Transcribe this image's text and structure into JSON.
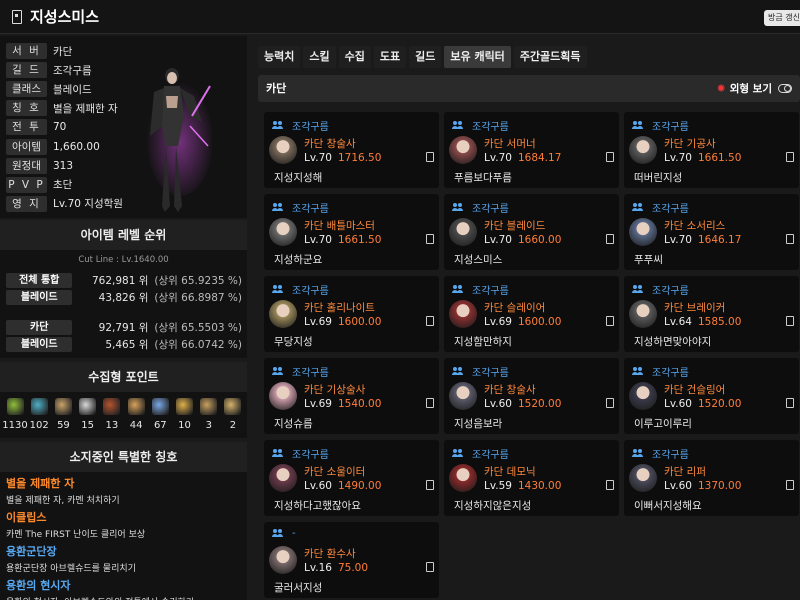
{
  "header": {
    "title": "지성스미스",
    "refresh_label": "방금 갱신"
  },
  "profile": {
    "rows": [
      {
        "label": "서 버",
        "value": "카단"
      },
      {
        "label": "길 드",
        "value": "조각구름"
      },
      {
        "label": "클래스",
        "value": "블레이드"
      },
      {
        "label": "칭 호",
        "value": "별을 제패한 자"
      },
      {
        "label": "전 투",
        "value": "70"
      },
      {
        "label": "아이템",
        "value": "1,660.00"
      },
      {
        "label": "원정대",
        "value": "313"
      },
      {
        "label": "P V P",
        "value": "초단"
      },
      {
        "label": "영 지",
        "value": "Lv.70 지성학원"
      }
    ]
  },
  "ranking": {
    "title": "아이템 레벨 순위",
    "cutline": "Cut Line : Lv.1640.00",
    "rows": [
      {
        "label": "전체 통합",
        "rank": "762,981 위",
        "pct": "(상위  65.9235 %)"
      },
      {
        "label": "블레이드",
        "rank": "43,826 위",
        "pct": "(상위  66.8987 %)"
      },
      {
        "label": "카단",
        "rank": "92,791 위",
        "pct": "(상위  65.5503 %)"
      },
      {
        "label": "블레이드",
        "rank": "5,465 위",
        "pct": "(상위  66.0742 %)"
      }
    ]
  },
  "points": {
    "title": "수집형 포인트",
    "items": [
      {
        "icon": "mokoko-seed-icon",
        "value": "1130",
        "color": "#8fbf3a"
      },
      {
        "icon": "island-heart-icon",
        "value": "102",
        "color": "#4fb0c6"
      },
      {
        "icon": "art-map-icon",
        "value": "59",
        "color": "#c9a36a"
      },
      {
        "icon": "giant-heart-icon",
        "value": "15",
        "color": "#d8d8d8"
      },
      {
        "icon": "ignea-token-icon",
        "value": "13",
        "color": "#b5542f"
      },
      {
        "icon": "adventure-tome-icon",
        "value": "44",
        "color": "#d8a25a"
      },
      {
        "icon": "world-tree-leaf-icon",
        "value": "67",
        "color": "#7aa8e6"
      },
      {
        "icon": "orpheus-star-icon",
        "value": "10",
        "color": "#e0b04a"
      },
      {
        "icon": "sea-bounty-icon",
        "value": "3",
        "color": "#c8a060"
      },
      {
        "icon": "omnium-star-icon",
        "value": "2",
        "color": "#d6b26a"
      }
    ]
  },
  "special_titles": {
    "title": "소지중인 특별한 칭호",
    "items": [
      {
        "name": "별을 제패한 자",
        "desc": "별을 제패한 자, 카멘 처치하기",
        "color": "#ff8a2a"
      },
      {
        "name": "이클립스",
        "desc": "카멘 The FIRST 난이도 클리어 보상",
        "color": "#ff8a2a"
      },
      {
        "name": "용환군단장",
        "desc": "용환군단장 아브렐슈드를 물리치기",
        "color": "#58a8f0"
      },
      {
        "name": "용환의 현시자",
        "desc": "용환의 현시자, 아브렐슈드와의 전투에서 승리하기",
        "color": "#58a8f0"
      }
    ]
  },
  "tabs": [
    "능력치",
    "스킬",
    "수집",
    "도표",
    "길드",
    "보유 캐릭터",
    "주간골드획득"
  ],
  "active_tab": "보유 캐릭터",
  "server_bar": {
    "name": "카단",
    "outfit_label": "외형 보기"
  },
  "characters": [
    {
      "guild": "조각구름",
      "cls": "카단  창술사",
      "lvl": "Lv.70",
      "ilvl": "1716.50",
      "nick": "지성지성해",
      "tone": "#7a6a5a"
    },
    {
      "guild": "조각구름",
      "cls": "카단  서머너",
      "lvl": "Lv.70",
      "ilvl": "1684.17",
      "nick": "푸름보다푸름",
      "tone": "#8a4a4a"
    },
    {
      "guild": "조각구름",
      "cls": "카단  기공사",
      "lvl": "Lv.70",
      "ilvl": "1661.50",
      "nick": "떠버린지성",
      "tone": "#5a5a5a"
    },
    {
      "guild": "조각구름",
      "cls": "카단  배틀마스터",
      "lvl": "Lv.70",
      "ilvl": "1661.50",
      "nick": "지성하군요",
      "tone": "#6a6a6a"
    },
    {
      "guild": "조각구름",
      "cls": "카단  블레이드",
      "lvl": "Lv.70",
      "ilvl": "1660.00",
      "nick": "지성스미스",
      "tone": "#4a4a4a"
    },
    {
      "guild": "조각구름",
      "cls": "카단  소서리스",
      "lvl": "Lv.70",
      "ilvl": "1646.17",
      "nick": "푸푸씨",
      "tone": "#5a6a8a"
    },
    {
      "guild": "조각구름",
      "cls": "카단  홀리나이트",
      "lvl": "Lv.69",
      "ilvl": "1600.00",
      "nick": "무당지성",
      "tone": "#9a8a5a"
    },
    {
      "guild": "조각구름",
      "cls": "카단  슬레이어",
      "lvl": "Lv.69",
      "ilvl": "1600.00",
      "nick": "지성함만하지",
      "tone": "#8a3030"
    },
    {
      "guild": "조각구름",
      "cls": "카단  브레이커",
      "lvl": "Lv.64",
      "ilvl": "1585.00",
      "nick": "지성하면맞아야지",
      "tone": "#5a5a5a"
    },
    {
      "guild": "조각구름",
      "cls": "카단  기상술사",
      "lvl": "Lv.69",
      "ilvl": "1540.00",
      "nick": "지성슈름",
      "tone": "#c99aa8"
    },
    {
      "guild": "조각구름",
      "cls": "카단  창술사",
      "lvl": "Lv.60",
      "ilvl": "1520.00",
      "nick": "지성음보라",
      "tone": "#5a5a6a"
    },
    {
      "guild": "조각구름",
      "cls": "카단  건슬링어",
      "lvl": "Lv.60",
      "ilvl": "1520.00",
      "nick": "이루고이루리",
      "tone": "#3a3a4a"
    },
    {
      "guild": "조각구름",
      "cls": "카단  소울이터",
      "lvl": "Lv.60",
      "ilvl": "1490.00",
      "nick": "지성하다고했잖아요",
      "tone": "#6a3a4a"
    },
    {
      "guild": "조각구름",
      "cls": "카단  데모닉",
      "lvl": "Lv.59",
      "ilvl": "1430.00",
      "nick": "지성하지않은지성",
      "tone": "#8a2a2a"
    },
    {
      "guild": "조각구름",
      "cls": "카단  리퍼",
      "lvl": "Lv.60",
      "ilvl": "1370.00",
      "nick": "이뻐서지성해요",
      "tone": "#4a4a5a"
    },
    {
      "guild": "-",
      "cls": "카단  환수사",
      "lvl": "Lv.16",
      "ilvl": "75.00",
      "nick": "굴러서지성",
      "tone": "#7a6a6a"
    }
  ]
}
